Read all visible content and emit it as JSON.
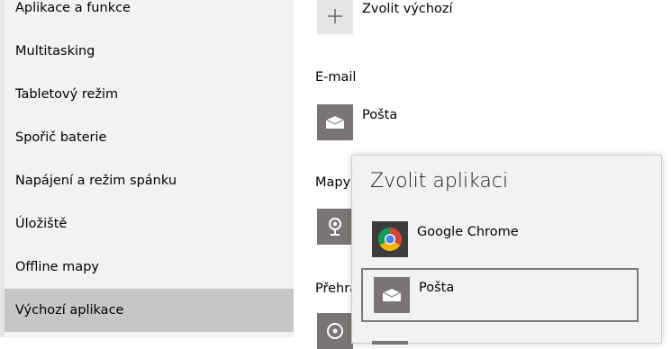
{
  "sidebar": {
    "items": [
      {
        "label": "Aplikace a funkce"
      },
      {
        "label": "Multitasking"
      },
      {
        "label": "Tabletový režim"
      },
      {
        "label": "Spořič baterie"
      },
      {
        "label": "Napájení a režim spánku"
      },
      {
        "label": "Úložiště"
      },
      {
        "label": "Offline mapy"
      },
      {
        "label": "Výchozí aplikace"
      }
    ],
    "selected": "Výchozí aplikace"
  },
  "content": {
    "choose_default_label": "Zvolit výchozí",
    "email_section": "E-mail",
    "email_app": "Pošta",
    "maps_section_partial": "Mapy",
    "player_section_partial": "Přehrá"
  },
  "popup": {
    "title": "Zvolit aplikaci",
    "items": [
      {
        "label": "Google Chrome",
        "icon": "chrome-icon"
      },
      {
        "label": "Pošta",
        "icon": "mail-icon"
      }
    ]
  },
  "colors": {
    "sidebar_bg": "#f2f2f2",
    "selected_nav_bg": "#c8c6c4",
    "tile_gray": "#7a7574",
    "popup_bg": "#f2f2f2"
  }
}
